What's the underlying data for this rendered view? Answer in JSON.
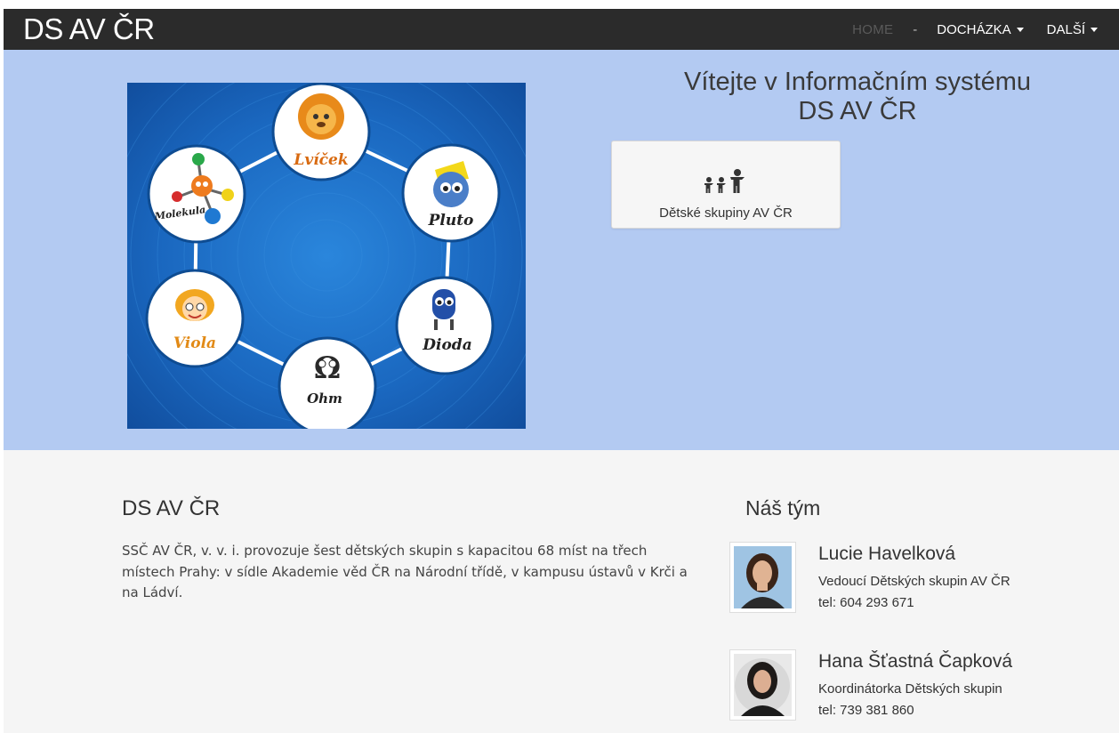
{
  "navbar": {
    "brand": "DS AV ČR",
    "home": "HOME",
    "separator": "-",
    "menu_attendance": "DOCHÁZKA",
    "menu_more": "DALŠÍ"
  },
  "hero": {
    "title_line1": "Vítejte v Informačním systému",
    "title_line2": "DS AV ČR",
    "card_label": "Dětské skupiny AV ČR",
    "logo": {
      "characters": [
        "Lvíček",
        "Pluto",
        "Dioda",
        "Ohm",
        "Viola",
        "Molekula"
      ]
    }
  },
  "about": {
    "title": "DS AV ČR",
    "text": "SSČ AV ČR, v. v. i. provozuje šest dětských skupin s kapacitou 68 míst na třech místech Prahy: v sídle Akademie věd ČR na Národní třídě, v kampusu ústavů v Krči a na Ládví."
  },
  "team": {
    "title": "Náš tým",
    "members": [
      {
        "name": "Lucie Havelková",
        "role": "Vedoucí Dětských skupin AV ČR",
        "tel": "tel: 604 293 671"
      },
      {
        "name": "Hana Šťastná Čapková",
        "role": "Koordinátorka Dětských skupin",
        "tel": "tel: 739 381 860"
      }
    ]
  },
  "colors": {
    "navbar_bg": "#2b2b2b",
    "hero_bg": "#b3caf2",
    "logo_bg": "#1d6ec6",
    "content_bg": "#f5f5f5"
  }
}
